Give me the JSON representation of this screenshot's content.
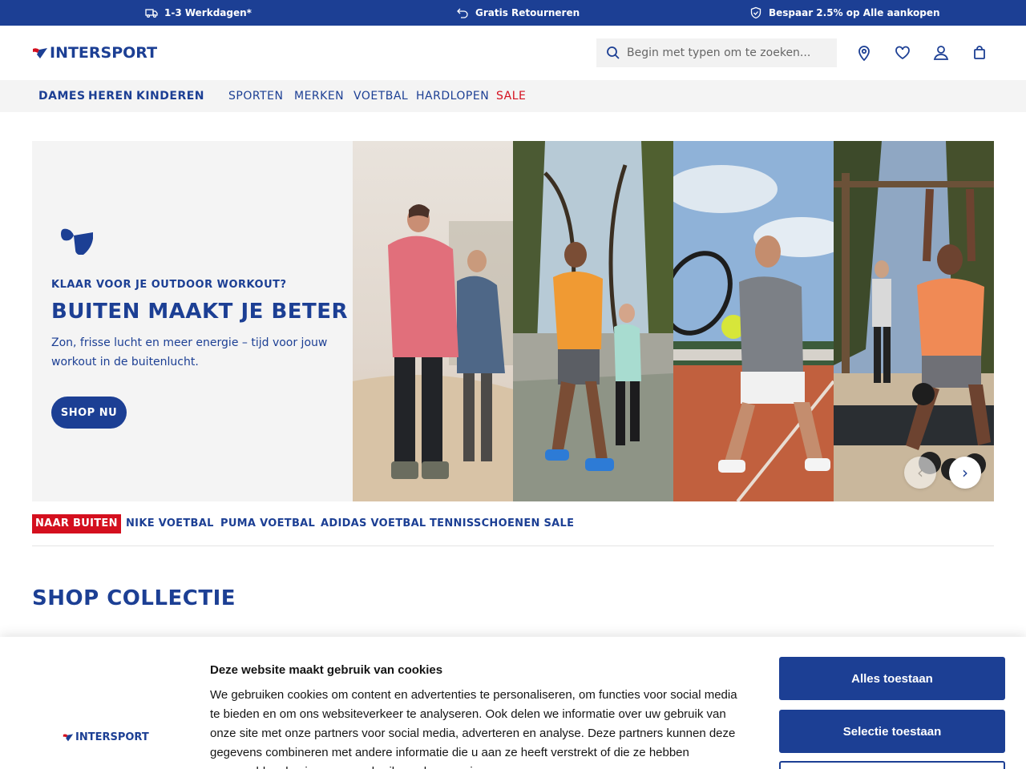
{
  "promo": {
    "delivery": "1-3 Werkdagen*",
    "returns": "Gratis Retourneren",
    "savings": "Bespaar 2.5% op Alle aankopen"
  },
  "header": {
    "logo": "INTERSPORT",
    "search_placeholder": "Begin met typen om te zoeken..."
  },
  "nav": {
    "primary": [
      "DAMES",
      "HEREN",
      "KINDEREN"
    ],
    "secondary": [
      "SPORTEN",
      "MERKEN",
      "VOETBAL",
      "HARDLOPEN"
    ],
    "sale": "SALE"
  },
  "hero": {
    "eyebrow": "KLAAR VOOR JE OUTDOOR WORKOUT?",
    "title": "BUITEN MAAKT JE BETER",
    "description": "Zon, frisse lucht en meer energie – tijd voor jouw workout in de buitenlucht.",
    "cta": "SHOP NU",
    "prev": "‹",
    "next": "›"
  },
  "tags": [
    "NAAR BUITEN",
    "NIKE VOETBAL",
    "PUMA VOETBAL",
    "ADIDAS VOETBAL",
    "TENNISSCHOENEN SALE"
  ],
  "section_title": "SHOP COLLECTIE",
  "cookie": {
    "logo": "INTERSPORT",
    "title": "Deze website maakt gebruik van cookies",
    "text": "We gebruiken cookies om content en advertenties te personaliseren, om functies voor social media te bieden en om ons websiteverkeer te analyseren. Ook delen we informatie over uw gebruik van onze site met onze partners voor social media, adverteren en analyse. Deze partners kunnen deze gegevens combineren met andere informatie die u aan ze heeft verstrekt of die ze hebben verzameld op basis van uw gebruik van hun services.",
    "allow_all": "Alles toestaan",
    "allow_selection": "Selectie toestaan"
  },
  "colors": {
    "brand_blue": "#1c3f94",
    "brand_red": "#d40f1e"
  }
}
